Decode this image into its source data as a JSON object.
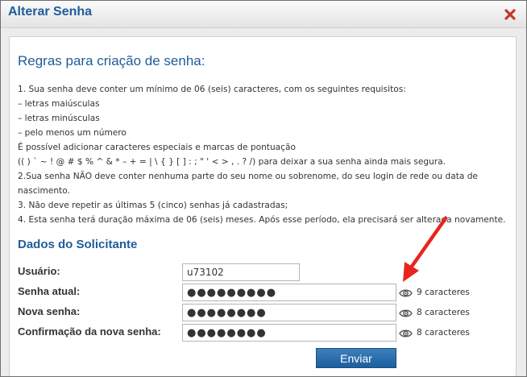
{
  "dialog": {
    "title": "Alterar Senha",
    "close_icon": "close-x-icon",
    "close_color": "#c0392b"
  },
  "rules": {
    "title": "Regras para criação de senha:",
    "lines": [
      "1. Sua senha deve conter um mínimo de 06 (seis) caracteres, com os seguintes requisitos:",
      "– letras maiúsculas",
      "– letras minúsculas",
      "– pelo menos um número",
      "É possível adicionar caracteres especiais e marcas de pontuação",
      "(( ) ` ~ ! @ # $ % ^ & * – + = | \\ { } [ ] : ; \" ' < > , . ? /) para deixar a sua senha ainda mais segura.",
      "2.Sua senha NÃO deve conter nenhuma parte do seu nome ou sobrenome, do seu login de rede ou data de nascimento.",
      "3. Não deve repetir as últimas 5 (cinco) senhas já cadastradas;",
      "4. Esta senha terá duração máxima de 06 (seis) meses. Após esse período, ela precisará ser alterada novamente."
    ]
  },
  "requester": {
    "title": "Dados do Solicitante",
    "user": {
      "label": "Usuário:",
      "value": "u73102"
    },
    "current": {
      "label": "Senha atual:",
      "value": "●●●●●●●●●",
      "count": "9 caracteres"
    },
    "new": {
      "label": "Nova senha:",
      "value": "●●●●●●●●",
      "count": "8 caracteres"
    },
    "confirm": {
      "label": "Confirmação da nova senha:",
      "value": "●●●●●●●●",
      "count": "8 caracteres"
    },
    "eye_icon": "eye-icon"
  },
  "submit_label": "Enviar",
  "colors": {
    "heading": "#1f5c99",
    "button": "#2a6cab",
    "annotation_arrow": "#e8251d"
  }
}
